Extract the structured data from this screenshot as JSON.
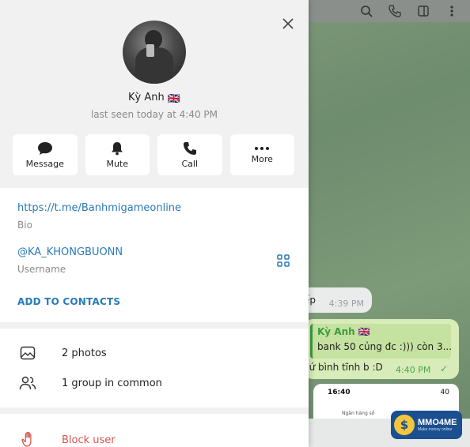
{
  "profile": {
    "name": "Kỳ Anh",
    "flag": "🇬🇧",
    "last_seen": "last seen today at 4:40 PM"
  },
  "actions": [
    {
      "label": "Message",
      "icon": "message-icon"
    },
    {
      "label": "Mute",
      "icon": "bell-icon"
    },
    {
      "label": "Call",
      "icon": "phone-icon"
    },
    {
      "label": "More",
      "icon": "more-icon"
    }
  ],
  "info": {
    "link": "https://t.me/Banhmigameonline",
    "bio_label": "Bio",
    "username": "@KA_KHONGBUONN",
    "username_label": "Username",
    "add_contacts": "ADD TO CONTACTS"
  },
  "media": {
    "photos": "2 photos",
    "groups": "1 group in common"
  },
  "block": {
    "label": "Block user"
  },
  "chat": {
    "partial_text": "ếp",
    "partial_time": "4:39 PM",
    "reply_name": "Kỳ Anh 🇬🇧",
    "reply_text": "bank 50 củng đc :))) còn 3...",
    "message": "cứ bình tĩnh b :D",
    "message_time": "4:40 PM",
    "image_status_time": "16:40",
    "image_status_right": "40",
    "image_line": "Ngân hàng số"
  },
  "watermark": {
    "brand": "MMO4ME",
    "tagline": "Make money online"
  },
  "colors": {
    "accent": "#2a7ab8",
    "danger": "#d9534f",
    "bubble_green": "#d7ecb8"
  }
}
